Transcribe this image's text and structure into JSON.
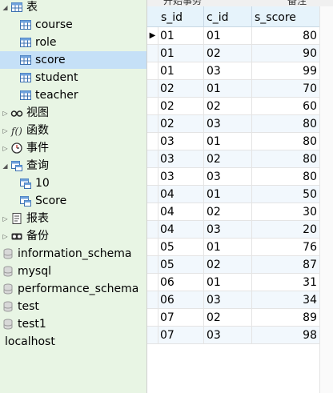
{
  "navigator": {
    "items": [
      {
        "label": "表",
        "icon": "table-folder-icon",
        "indent": 0,
        "expanded": true
      },
      {
        "label": "course",
        "icon": "table-icon",
        "indent": 1
      },
      {
        "label": "role",
        "icon": "table-icon",
        "indent": 1
      },
      {
        "label": "score",
        "icon": "table-icon",
        "indent": 1,
        "selected": true
      },
      {
        "label": "student",
        "icon": "table-icon",
        "indent": 1
      },
      {
        "label": "teacher",
        "icon": "table-icon",
        "indent": 1
      },
      {
        "label": "视图",
        "icon": "view-glasses-icon",
        "indent": 0,
        "expanded": false
      },
      {
        "label": "函数",
        "icon": "function-icon",
        "indent": 0,
        "expanded": false
      },
      {
        "label": "事件",
        "icon": "event-clock-icon",
        "indent": 0,
        "expanded": false
      },
      {
        "label": "查询",
        "icon": "query-folder-icon",
        "indent": 0,
        "expanded": true
      },
      {
        "label": "10",
        "icon": "query-icon",
        "indent": 1
      },
      {
        "label": "Score",
        "icon": "query-icon",
        "indent": 1
      },
      {
        "label": "报表",
        "icon": "report-icon",
        "indent": 0,
        "expanded": false
      },
      {
        "label": "备份",
        "icon": "backup-icon",
        "indent": 0,
        "expanded": false
      },
      {
        "label": "information_schema",
        "icon": "database-icon",
        "indent": -1
      },
      {
        "label": "mysql",
        "icon": "database-icon",
        "indent": -1
      },
      {
        "label": "performance_schema",
        "icon": "database-icon",
        "indent": -1
      },
      {
        "label": "test",
        "icon": "database-icon",
        "indent": -1
      },
      {
        "label": "test1",
        "icon": "database-icon",
        "indent": -1
      },
      {
        "label": "localhost",
        "icon": "",
        "indent": -2
      }
    ]
  },
  "toolbar": {
    "begin_transaction": "开始事务",
    "memo": "备注"
  },
  "grid": {
    "columns": [
      "s_id",
      "c_id",
      "s_score"
    ],
    "rows": [
      [
        "01",
        "01",
        "80"
      ],
      [
        "01",
        "02",
        "90"
      ],
      [
        "01",
        "03",
        "99"
      ],
      [
        "02",
        "01",
        "70"
      ],
      [
        "02",
        "02",
        "60"
      ],
      [
        "02",
        "03",
        "80"
      ],
      [
        "03",
        "01",
        "80"
      ],
      [
        "03",
        "02",
        "80"
      ],
      [
        "03",
        "03",
        "80"
      ],
      [
        "04",
        "01",
        "50"
      ],
      [
        "04",
        "02",
        "30"
      ],
      [
        "04",
        "03",
        "20"
      ],
      [
        "05",
        "01",
        "76"
      ],
      [
        "05",
        "02",
        "87"
      ],
      [
        "06",
        "01",
        "31"
      ],
      [
        "06",
        "03",
        "34"
      ],
      [
        "07",
        "02",
        "89"
      ],
      [
        "07",
        "03",
        "98"
      ]
    ],
    "current_row_marker": "▶"
  },
  "colors": {
    "navigator_bg": "#e8f5e4",
    "selected_bg": "#c5e0f7",
    "header_bg": "#e6f3fb",
    "alt_row_bg": "#f2f8fd"
  }
}
